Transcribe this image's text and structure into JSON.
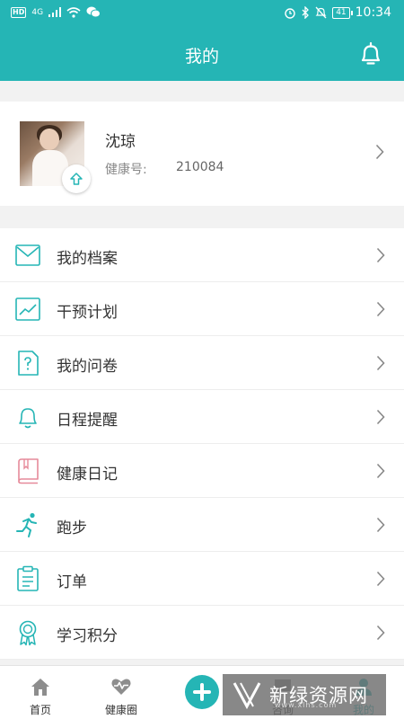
{
  "status": {
    "hd": "HD",
    "network": "4G",
    "battery": "41",
    "time": "10:34"
  },
  "header": {
    "title": "我的"
  },
  "profile": {
    "name": "沈琼",
    "health_label": "健康号:",
    "health_number": "210084"
  },
  "menu": {
    "items": [
      {
        "label": "我的档案",
        "icon": "envelope-icon"
      },
      {
        "label": "干预计划",
        "icon": "trend-chart-icon"
      },
      {
        "label": "我的问卷",
        "icon": "questionnaire-icon"
      },
      {
        "label": "日程提醒",
        "icon": "bell-icon"
      },
      {
        "label": "健康日记",
        "icon": "book-icon"
      },
      {
        "label": "跑步",
        "icon": "runner-icon"
      },
      {
        "label": "订单",
        "icon": "clipboard-icon"
      },
      {
        "label": "学习积分",
        "icon": "award-ribbon-icon"
      }
    ]
  },
  "tabbar": {
    "items": [
      {
        "label": "首页",
        "icon": "home-icon"
      },
      {
        "label": "健康圈",
        "icon": "heart-pulse-icon"
      },
      {
        "label": "",
        "icon": "plus-icon"
      },
      {
        "label": "咨询",
        "icon": "chat-icon"
      },
      {
        "label": "我的",
        "icon": "user-icon",
        "active": true
      }
    ]
  },
  "watermark": {
    "text": "新绿资源网",
    "url": "www.xlhs.com"
  },
  "colors": {
    "accent": "#25b5b5",
    "book_icon": "#e68a9a",
    "background": "#f2f2f2"
  }
}
